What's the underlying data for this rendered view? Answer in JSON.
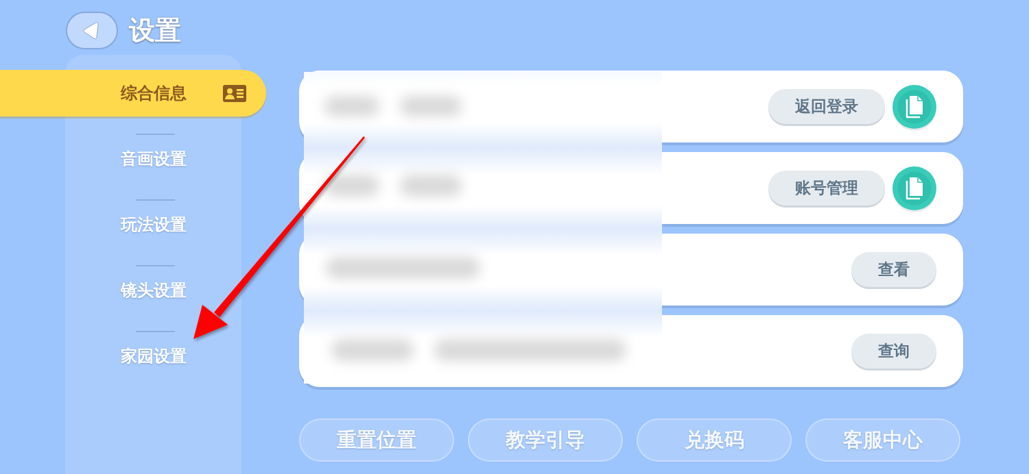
{
  "header": {
    "title": "设置"
  },
  "sidebar": {
    "items": [
      {
        "label": "综合信息",
        "selected": true
      },
      {
        "label": "音画设置",
        "selected": false
      },
      {
        "label": "玩法设置",
        "selected": false
      },
      {
        "label": "镜头设置",
        "selected": false
      },
      {
        "label": "家园设置",
        "selected": false
      }
    ]
  },
  "cards": [
    {
      "action": "返回登录",
      "copy_button": true
    },
    {
      "action": "账号管理",
      "copy_button": true
    },
    {
      "action": "查看",
      "copy_button": false
    },
    {
      "action": "查询",
      "copy_button": false
    }
  ],
  "bottom_buttons": [
    "重置位置",
    "教学引导",
    "兑换码",
    "客服中心"
  ]
}
